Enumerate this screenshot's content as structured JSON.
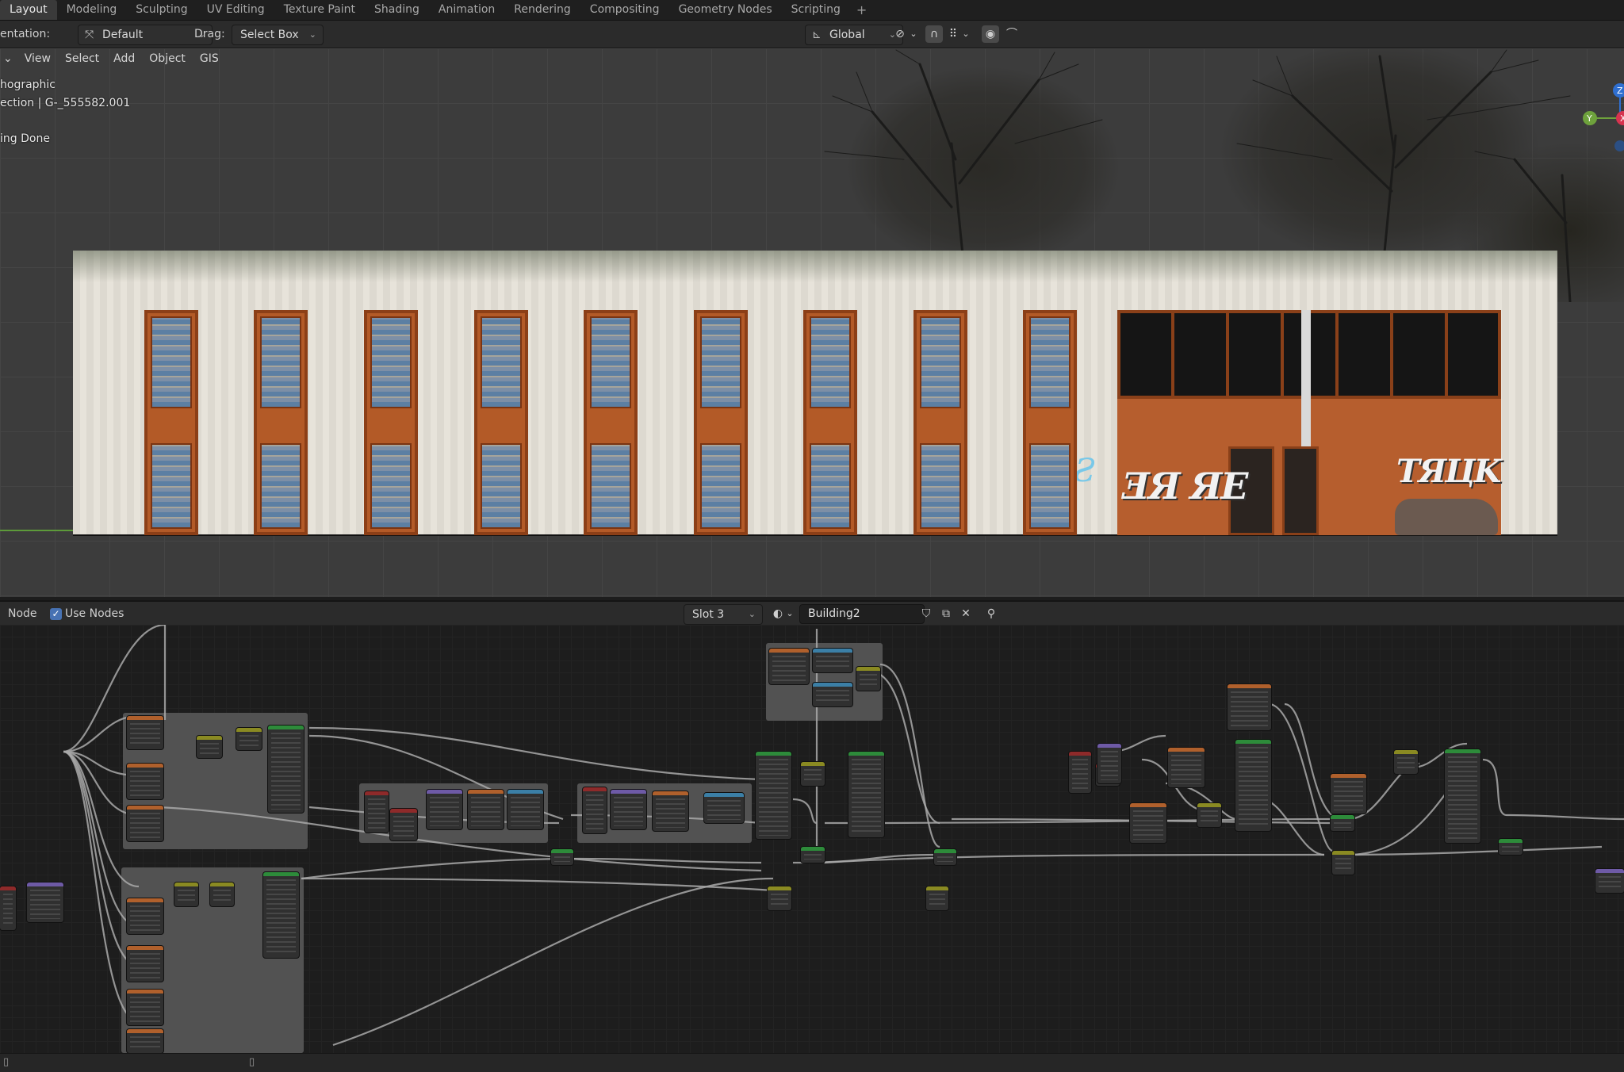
{
  "workspace_tabs": [
    "Layout",
    "Modeling",
    "Sculpting",
    "UV Editing",
    "Texture Paint",
    "Shading",
    "Animation",
    "Rendering",
    "Compositing",
    "Geometry Nodes",
    "Scripting"
  ],
  "active_tab": "Layout",
  "add_tab_symbol": "+",
  "toolbar": {
    "orientation_label": "entation:",
    "orientation_value": "Default",
    "drag_label": "Drag:",
    "drag_value": "Select Box",
    "transform_space": "Global"
  },
  "viewport": {
    "menu": [
      "View",
      "Select",
      "Add",
      "Object",
      "GIS"
    ],
    "overlay_lines": [
      "hographic",
      "ection | G-_555582.001",
      "ing Done"
    ],
    "gizmo_axes": {
      "z": "Z",
      "y": "Y",
      "x": "X"
    }
  },
  "graffiti": [
    "ƎЯ ЯЕ",
    "TЯЦK"
  ],
  "node_editor": {
    "menu_node": "Node",
    "use_nodes_label": "Use Nodes",
    "use_nodes_checked": true,
    "slot": "Slot 3",
    "material_name": "Building2"
  },
  "colors": {
    "accent_blue": "#4772b3",
    "node_header_orange": "#b0602c",
    "node_header_purple": "#6e5aa6",
    "node_header_green": "#2d8b3a",
    "node_header_teal": "#3b7fa6",
    "node_header_red": "#8e2a2a",
    "node_header_yellow": "#8a8a22"
  }
}
